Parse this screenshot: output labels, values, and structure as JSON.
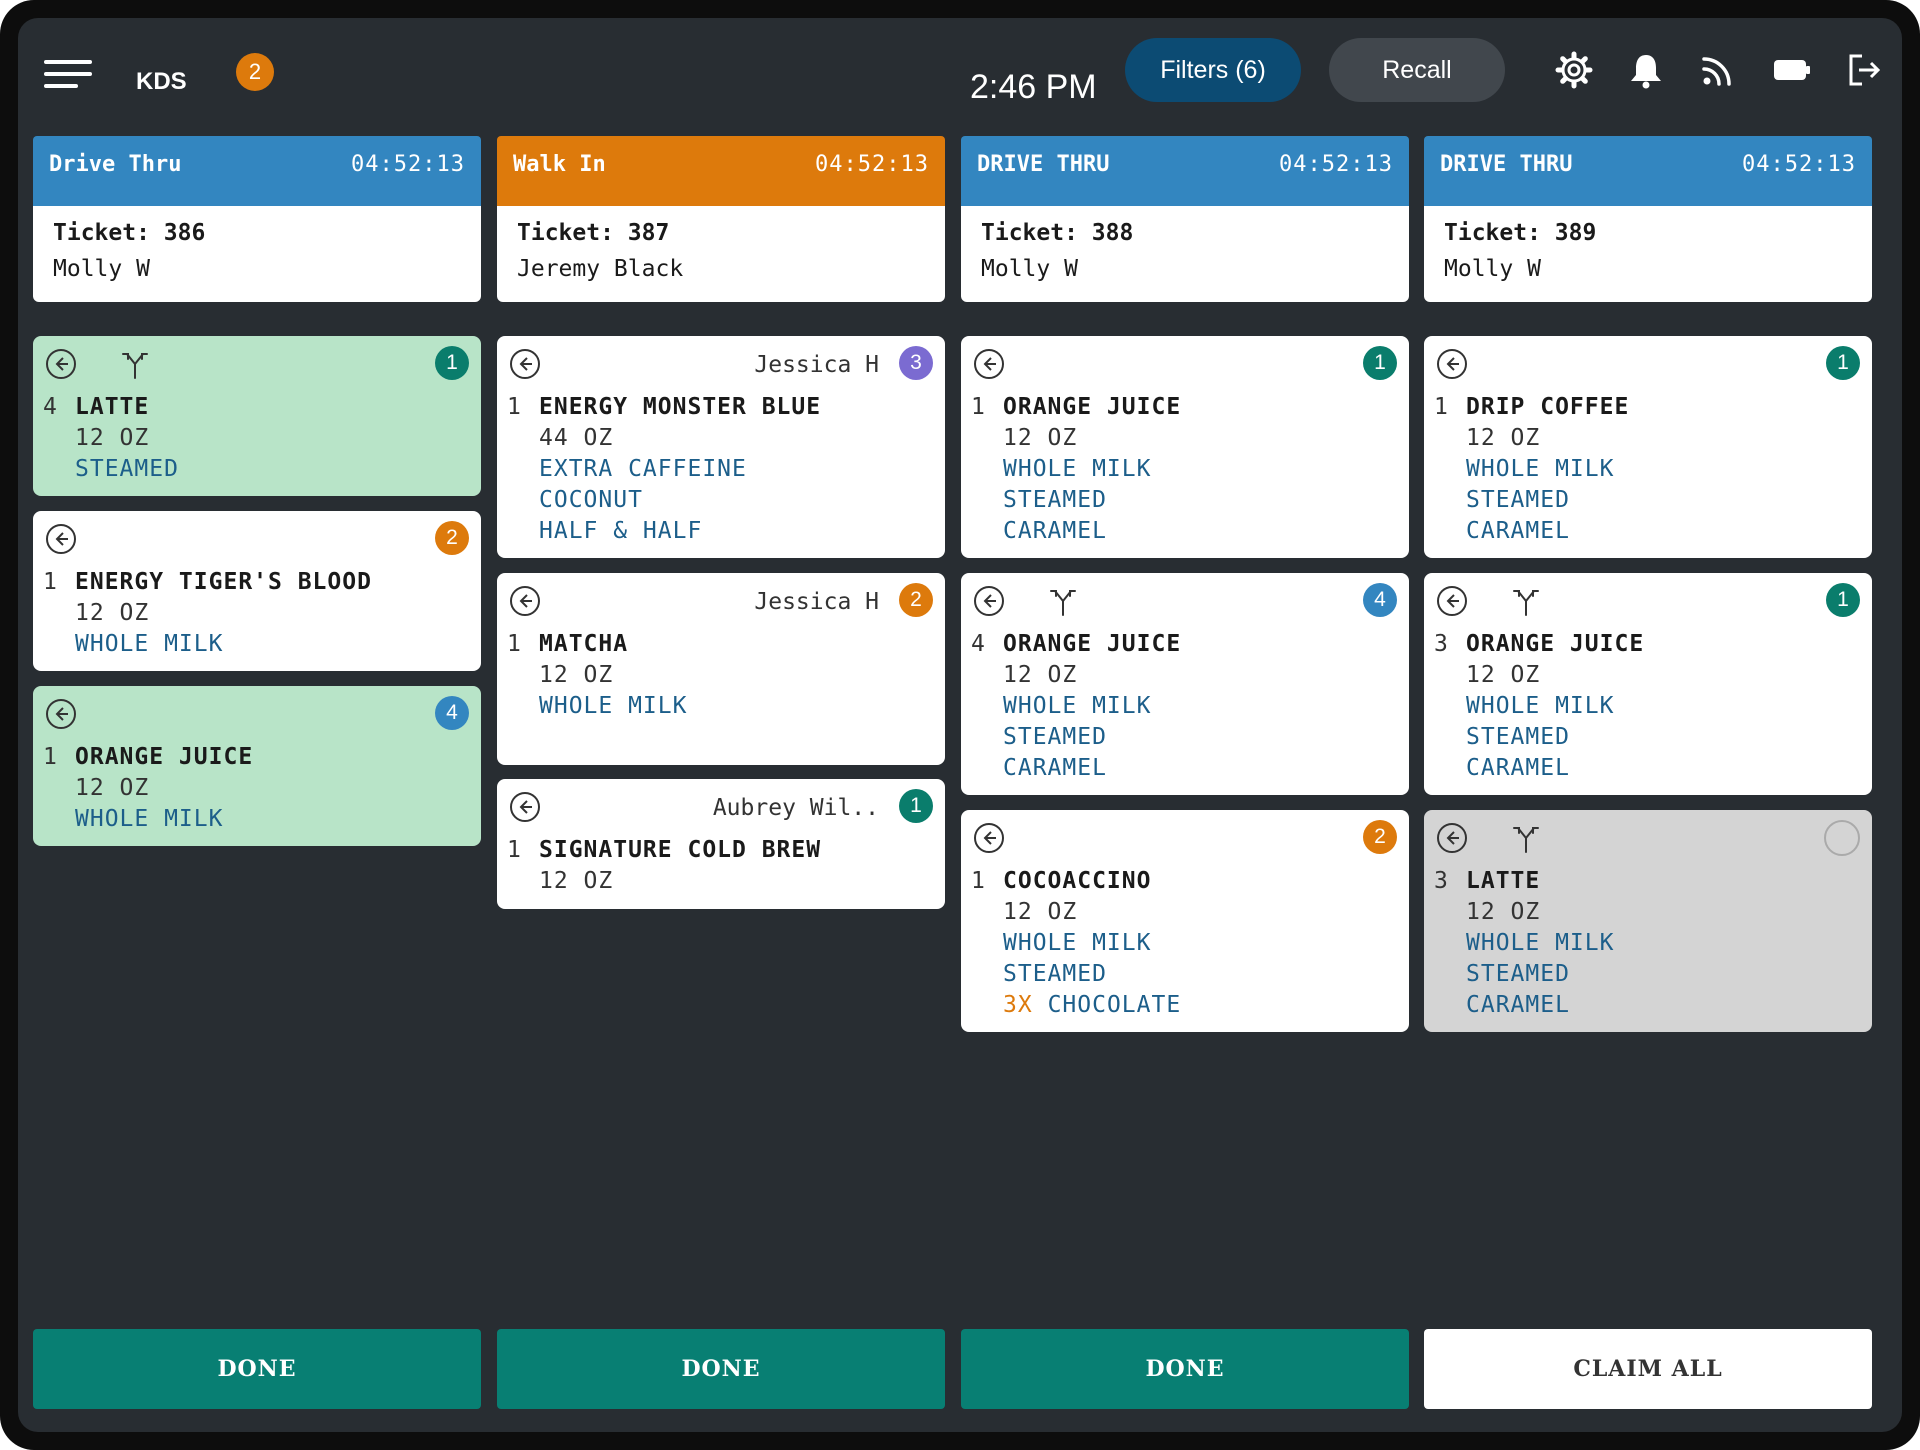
{
  "header": {
    "app_name": "KDS",
    "app_badge": "2",
    "time": "2:46 PM",
    "filters_label": "Filters (6)",
    "recall_label": "Recall",
    "icons": [
      "gear-icon",
      "bell-icon",
      "rss-icon",
      "battery-icon",
      "logout-icon"
    ]
  },
  "colors": {
    "drive_thru": "#3386c0",
    "walk_in": "#dd7a0c",
    "badge_green": "#0a7d6c",
    "badge_orange": "#dd7a0c",
    "badge_blue": "#3386c0",
    "badge_purple": "#7b6bd1",
    "done_button": "#087f73"
  },
  "columns": [
    {
      "order_type": "Drive Thru",
      "timer": "04:52:13",
      "ticket": "Ticket: 386",
      "customer": "Molly W",
      "cards": [
        {
          "item_qty": "4",
          "item_name": "LATTE",
          "size": "12 OZ",
          "mods": [
            "STEAMED"
          ],
          "badge": "1"
        },
        {
          "item_qty": "1",
          "item_name": "ENERGY TIGER'S BLOOD",
          "size": "12 OZ",
          "mods": [
            "WHOLE MILK"
          ],
          "badge": "2"
        },
        {
          "item_qty": "1",
          "item_name": "ORANGE JUICE",
          "size": "12 OZ",
          "mods": [
            "WHOLE MILK"
          ],
          "badge": "4"
        }
      ]
    },
    {
      "order_type": "Walk In",
      "timer": "04:52:13",
      "ticket": "Ticket: 387",
      "customer": "Jeremy Black",
      "cards": [
        {
          "assignee": "Jessica H",
          "item_qty": "1",
          "item_name": "ENERGY MONSTER BLUE",
          "size": "44 OZ",
          "mods": [
            "EXTRA CAFFEINE",
            "COCONUT",
            "HALF & HALF"
          ],
          "badge": "3"
        },
        {
          "assignee": "Jessica H",
          "item_qty": "1",
          "item_name": "MATCHA",
          "size": "12 OZ",
          "mods": [
            "WHOLE MILK"
          ],
          "badge": "2"
        },
        {
          "assignee": "Aubrey Wil..",
          "item_qty": "1",
          "item_name": "SIGNATURE COLD BREW",
          "size": "12 OZ",
          "mods": [],
          "badge": "1"
        }
      ]
    },
    {
      "order_type": "DRIVE THRU",
      "timer": "04:52:13",
      "ticket": "Ticket: 388",
      "customer": "Molly W",
      "cards": [
        {
          "item_qty": "1",
          "item_name": "ORANGE JUICE",
          "size": "12 OZ",
          "mods": [
            "WHOLE MILK",
            "STEAMED",
            "CARAMEL"
          ],
          "badge": "1"
        },
        {
          "item_qty": "4",
          "item_name": "ORANGE JUICE",
          "size": "12 OZ",
          "mods": [
            "WHOLE MILK",
            "STEAMED",
            "CARAMEL"
          ],
          "badge": "4"
        },
        {
          "item_qty": "1",
          "item_name": "COCOACCINO",
          "size": "12 OZ",
          "mods": [
            "WHOLE MILK",
            "STEAMED"
          ],
          "mod_multiplier": "3X",
          "mod_multiplied": "CHOCOLATE",
          "badge": "2"
        }
      ]
    },
    {
      "order_type": "DRIVE THRU",
      "timer": "04:52:13",
      "ticket": "Ticket: 389",
      "customer": "Molly W",
      "cards": [
        {
          "item_qty": "1",
          "item_name": "DRIP COFFEE",
          "size": "12 OZ",
          "mods": [
            "WHOLE MILK",
            "STEAMED",
            "CARAMEL"
          ],
          "badge": "1"
        },
        {
          "item_qty": "3",
          "item_name": "ORANGE JUICE",
          "size": "12 OZ",
          "mods": [
            "WHOLE MILK",
            "STEAMED",
            "CARAMEL"
          ],
          "badge": "1"
        },
        {
          "item_qty": "3",
          "item_name": "LATTE",
          "size": "12 OZ",
          "mods": [
            "WHOLE MILK",
            "STEAMED",
            "CARAMEL"
          ],
          "badge": ""
        }
      ]
    }
  ],
  "footer": {
    "done_label": "DONE",
    "claim_all_label": "CLAIM ALL"
  }
}
